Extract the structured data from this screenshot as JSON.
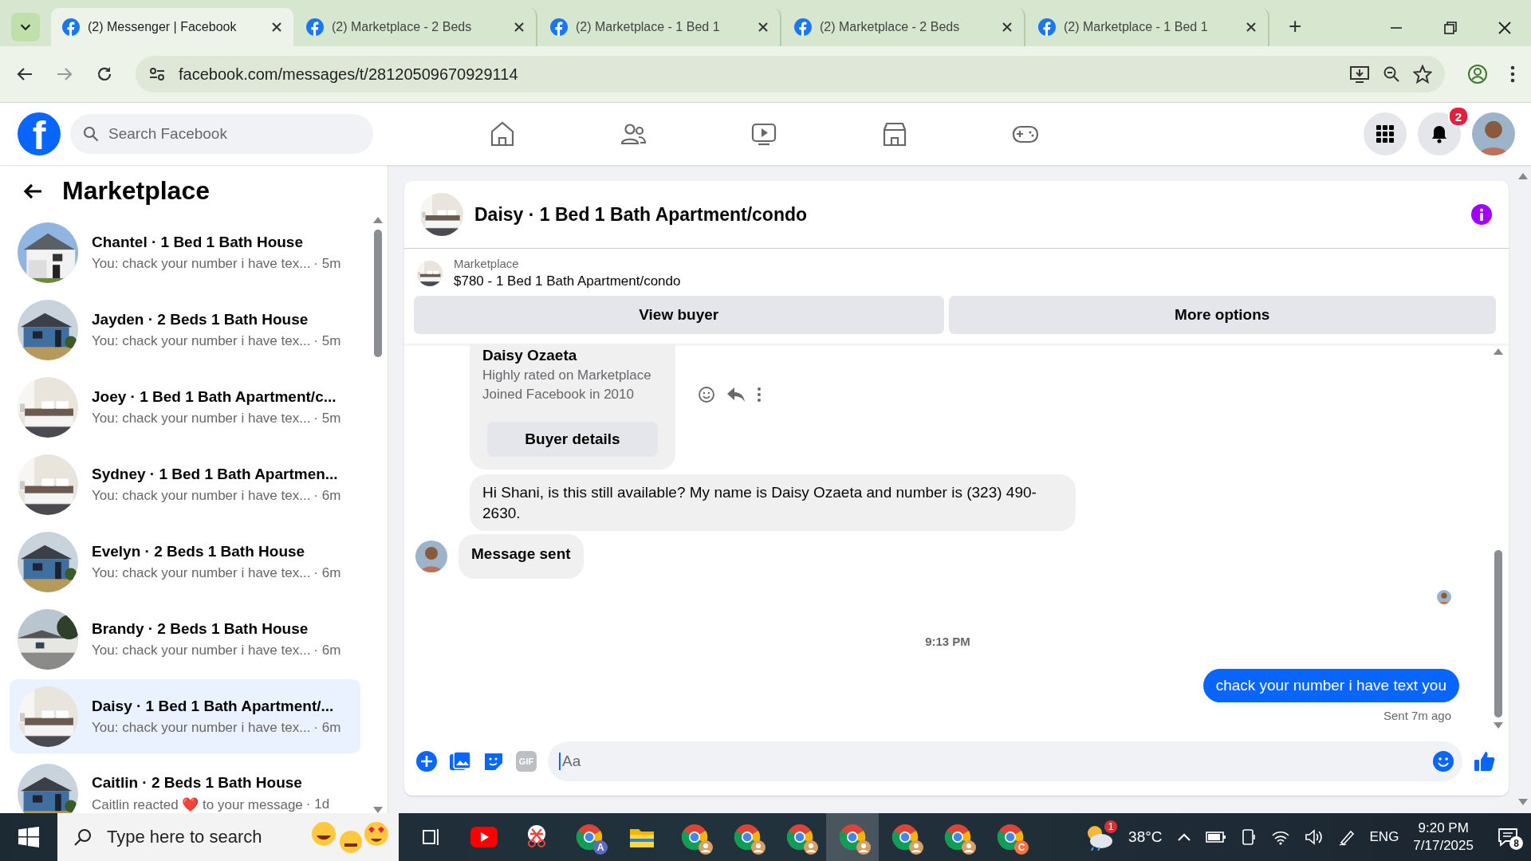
{
  "browser": {
    "tabs": [
      {
        "title": "(2) Messenger | Facebook",
        "selected": true
      },
      {
        "title": "(2) Marketplace - 2 Beds",
        "selected": false
      },
      {
        "title": "(2) Marketplace - 1 Bed 1",
        "selected": false
      },
      {
        "title": "(2) Marketplace - 2 Beds",
        "selected": false
      },
      {
        "title": "(2) Marketplace - 1 Bed 1",
        "selected": false
      }
    ],
    "new_tab": "+",
    "url": "facebook.com/messages/t/28120509670929114"
  },
  "facebook_header": {
    "logo": "f",
    "search": {
      "placeholder": "Search Facebook"
    },
    "notification_count": "2"
  },
  "sidebar": {
    "title": "Marketplace",
    "conversations": [
      {
        "title": "Chantel · 1 Bed 1 Bath House",
        "preview": "You: chack your number i have tex...",
        "time": "· 5m",
        "selected": false
      },
      {
        "title": "Jayden · 2 Beds 1 Bath House",
        "preview": "You: chack your number i have tex...",
        "time": "· 5m",
        "selected": false
      },
      {
        "title": "Joey · 1 Bed 1 Bath Apartment/c...",
        "preview": "You: chack your number i have tex...",
        "time": "· 5m",
        "selected": false
      },
      {
        "title": "Sydney · 1 Bed 1 Bath Apartmen...",
        "preview": "You: chack your number i have tex...",
        "time": "· 6m",
        "selected": false
      },
      {
        "title": "Evelyn · 2 Beds 1 Bath House",
        "preview": "You: chack your number i have tex...",
        "time": "· 6m",
        "selected": false
      },
      {
        "title": "Brandy · 2 Beds 1 Bath House",
        "preview": "You: chack your number i have tex...",
        "time": "· 6m",
        "selected": false
      },
      {
        "title": "Daisy · 1 Bed 1 Bath Apartment/...",
        "preview": "You: chack your number i have tex...",
        "time": "· 6m",
        "selected": true
      },
      {
        "title": "Caitlin · 2 Beds 1 Bath House",
        "preview": "Caitlin reacted ❤️ to your message",
        "time": "· 1d",
        "selected": false
      }
    ]
  },
  "chat": {
    "title": "Daisy · 1 Bed 1 Bath Apartment/condo",
    "listing": {
      "label": "Marketplace",
      "title": "$780 - 1 Bed 1 Bath Apartment/condo"
    },
    "buttons": [
      "View buyer",
      "More options"
    ],
    "buyer_card": {
      "name": "Daisy Ozaeta",
      "lines": [
        "Highly rated on Marketplace",
        "Joined Facebook in 2010"
      ],
      "button": "Buyer details"
    },
    "messages": [
      {
        "kind": "received",
        "text": "Hi Shani, is this still available? My name is Daisy Ozaeta and number is (323) 490-2630."
      },
      {
        "kind": "notice",
        "text": "Message sent"
      },
      {
        "kind": "timestamp",
        "text": "9:13 PM"
      },
      {
        "kind": "sent",
        "text": "chack your number i have text you"
      }
    ],
    "status": "Sent 7m ago",
    "composer": {
      "placeholder": "Aa",
      "gif": "GIF"
    }
  },
  "taskbar": {
    "search": {
      "placeholder": "Type here to search"
    },
    "apps": [
      {
        "kind": "taskview",
        "active": false
      },
      {
        "kind": "youtube",
        "active": false
      },
      {
        "kind": "snip",
        "active": false
      },
      {
        "kind": "chrome",
        "badge": "A",
        "active": false
      },
      {
        "kind": "folder",
        "active": false
      },
      {
        "kind": "chrome",
        "active": false
      },
      {
        "kind": "chrome",
        "active": false
      },
      {
        "kind": "chrome",
        "active": false
      },
      {
        "kind": "chrome",
        "active": true
      },
      {
        "kind": "chrome",
        "active": false
      },
      {
        "kind": "chrome",
        "active": false
      },
      {
        "kind": "chrome",
        "badge": "C",
        "active": false
      }
    ],
    "weather_badge": "1",
    "temperature": "38°C",
    "language": "ENG",
    "time": "9:20 PM",
    "date": "7/17/2025",
    "notifications": "8"
  }
}
